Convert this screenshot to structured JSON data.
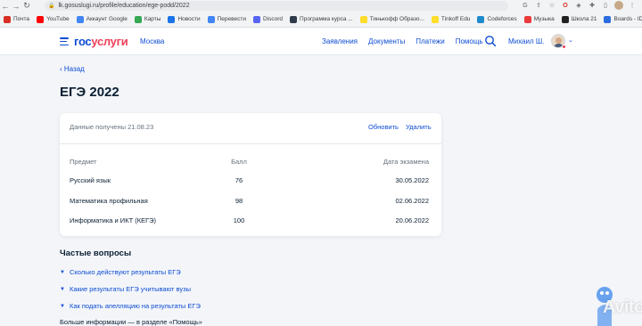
{
  "browser": {
    "url": "lk.gosuslugi.ru/profile/education/ege-podd/2022",
    "bookmarks": [
      {
        "label": "Почта",
        "color": "#d93025"
      },
      {
        "label": "YouTube",
        "color": "#ff0000"
      },
      {
        "label": "Аккаунт Google",
        "color": "#4285f4"
      },
      {
        "label": "Карты",
        "color": "#34a853"
      },
      {
        "label": "Новости",
        "color": "#1a73e8"
      },
      {
        "label": "Перевести",
        "color": "#4285f4"
      },
      {
        "label": "Discord",
        "color": "#5865f2"
      },
      {
        "label": "Программа курса ...",
        "color": "#2f3a4a"
      },
      {
        "label": "Тинькофф Образо...",
        "color": "#ffdd2d"
      },
      {
        "label": "Tinkoff Edu",
        "color": "#ffdd2d"
      },
      {
        "label": "Codeforces",
        "color": "#1f8acb"
      },
      {
        "label": "Музыка",
        "color": "#e93b3b"
      },
      {
        "label": "Школа 21",
        "color": "#222222"
      },
      {
        "label": "Boards - IDroo",
        "color": "#2d6cdf"
      }
    ]
  },
  "header": {
    "logo_part1": "гос",
    "logo_part2": "услуги",
    "city": "Москва",
    "nav": [
      "Заявления",
      "Документы",
      "Платежи",
      "Помощь"
    ],
    "user": "Михаил Ш."
  },
  "page": {
    "back": "Назад",
    "title": "ЕГЭ 2022"
  },
  "card": {
    "received": "Данные получены 21.08.23",
    "refresh": "Обновить",
    "delete": "Удалить",
    "columns": [
      "Предмет",
      "Балл",
      "Дата экзамена"
    ],
    "rows": [
      [
        "Русский язык",
        "76",
        "30.05.2022"
      ],
      [
        "Математика профильная",
        "98",
        "02.06.2022"
      ],
      [
        "Информатика и ИКТ (КЕГЭ)",
        "100",
        "20.06.2022"
      ]
    ]
  },
  "faq": {
    "title": "Частые вопросы",
    "items": [
      "Сколько действуют результаты ЕГЭ",
      "Какие результаты ЕГЭ учитывают вузы",
      "Как подать апелляцию на результаты ЕГЭ"
    ],
    "more": "Больше информации — в разделе «Помощь»"
  },
  "watermark": "Avito"
}
